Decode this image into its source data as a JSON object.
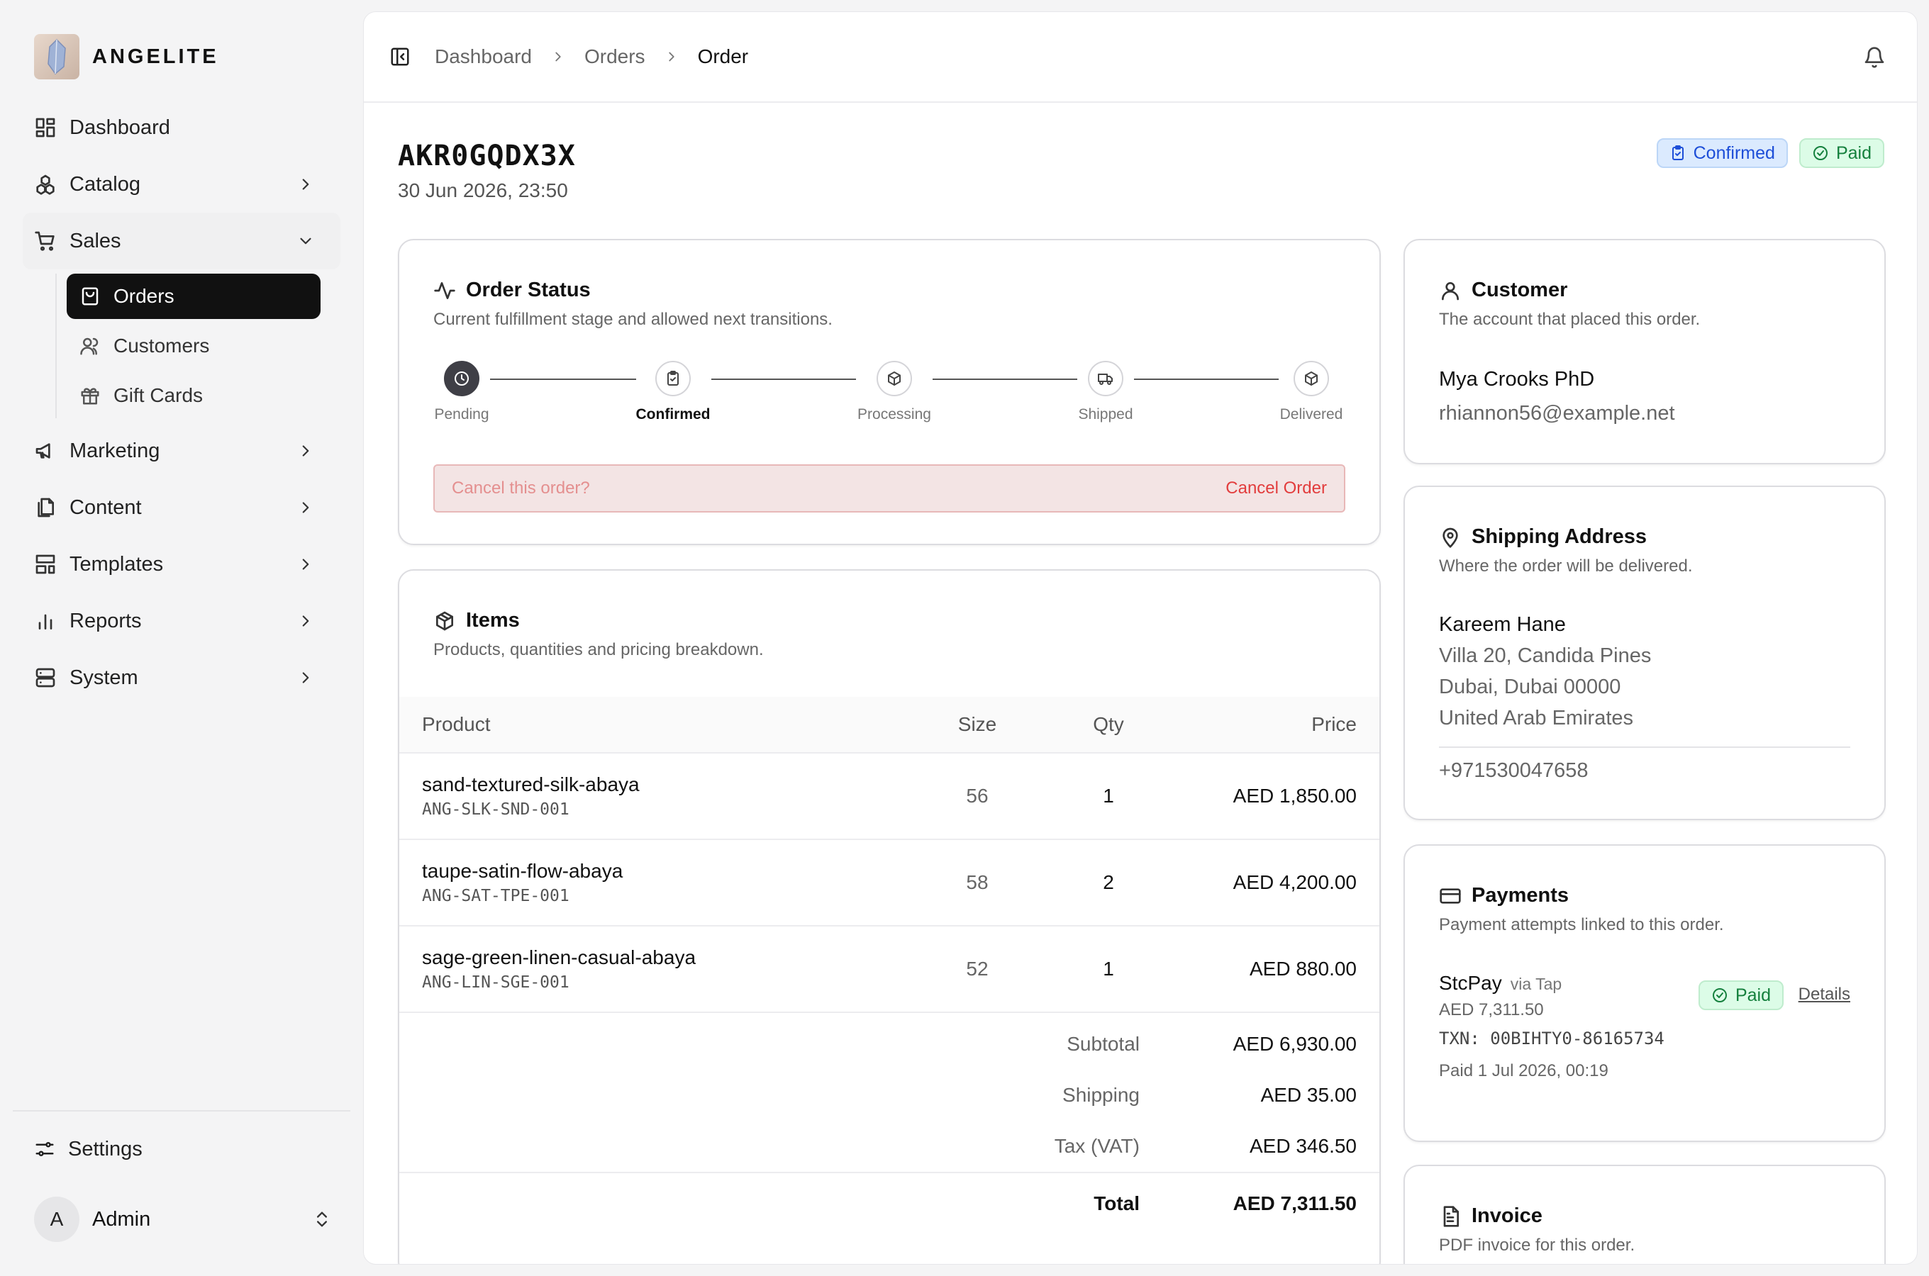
{
  "brand": {
    "name": "ANGELITE"
  },
  "nav": {
    "dashboard": "Dashboard",
    "catalog": "Catalog",
    "sales": "Sales",
    "orders": "Orders",
    "customers": "Customers",
    "gift_cards": "Gift Cards",
    "marketing": "Marketing",
    "content": "Content",
    "templates": "Templates",
    "reports": "Reports",
    "system": "System",
    "settings": "Settings"
  },
  "user": {
    "initial": "A",
    "name": "Admin"
  },
  "breadcrumb": [
    "Dashboard",
    "Orders",
    "Order"
  ],
  "order": {
    "id": "AKR0GQDX3X",
    "date": "30 Jun 2026, 23:50",
    "status_badge": "Confirmed",
    "payment_badge": "Paid"
  },
  "status_card": {
    "title": "Order Status",
    "subtitle": "Current fulfillment stage and allowed next transitions.",
    "steps": [
      "Pending",
      "Confirmed",
      "Processing",
      "Shipped",
      "Delivered"
    ],
    "current_step": "Confirmed",
    "cancel_prompt": "Cancel this order?",
    "cancel_button": "Cancel Order"
  },
  "items_card": {
    "title": "Items",
    "subtitle": "Products, quantities and pricing breakdown.",
    "columns": [
      "Product",
      "Size",
      "Qty",
      "Price"
    ],
    "rows": [
      {
        "name": "sand-textured-silk-abaya",
        "sku": "ANG-SLK-SND-001",
        "size": "56",
        "qty": "1",
        "price": "AED 1,850.00"
      },
      {
        "name": "taupe-satin-flow-abaya",
        "sku": "ANG-SAT-TPE-001",
        "size": "58",
        "qty": "2",
        "price": "AED 4,200.00"
      },
      {
        "name": "sage-green-linen-casual-abaya",
        "sku": "ANG-LIN-SGE-001",
        "size": "52",
        "qty": "1",
        "price": "AED 880.00"
      }
    ],
    "subtotal_label": "Subtotal",
    "subtotal": "AED 6,930.00",
    "shipping_label": "Shipping",
    "shipping": "AED 35.00",
    "tax_label": "Tax (VAT)",
    "tax": "AED 346.50",
    "total_label": "Total",
    "total": "AED 7,311.50"
  },
  "customer_card": {
    "title": "Customer",
    "subtitle": "The account that placed this order.",
    "name": "Mya Crooks PhD",
    "email": "rhiannon56@example.net"
  },
  "shipping_card": {
    "title": "Shipping Address",
    "subtitle": "Where the order will be delivered.",
    "name": "Kareem Hane",
    "line1": "Villa 20, Candida Pines",
    "line2": "Dubai, Dubai 00000",
    "country": "United Arab Emirates",
    "phone": "+971530047658"
  },
  "payments_card": {
    "title": "Payments",
    "subtitle": "Payment attempts linked to this order.",
    "method": "StcPay",
    "via": "via Tap",
    "amount": "AED 7,311.50",
    "txn": "TXN: 00BIHTY0-86165734",
    "paid_at": "Paid 1 Jul 2026, 00:19",
    "status": "Paid",
    "details_link": "Details"
  },
  "invoice_card": {
    "title": "Invoice",
    "subtitle": "PDF invoice for this order."
  },
  "colors": {
    "confirmed_badge": "#dbeafe",
    "paid_badge": "#dcfce7",
    "cancel_bar": "#f3e4e4",
    "cancel_text": "#e23d3d",
    "active_nav": "#111111"
  }
}
